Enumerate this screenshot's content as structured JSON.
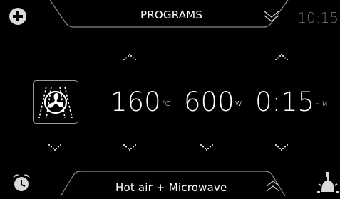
{
  "header": {
    "title": "PROGRAMS",
    "time": "10:15"
  },
  "settings": {
    "temperature": {
      "value": "160",
      "unit": "°C"
    },
    "power": {
      "value": "600",
      "unit": "W"
    },
    "duration": {
      "value": "0:15",
      "unit": "H:M"
    }
  },
  "footer": {
    "mode_label": "Hot air + Microwave"
  },
  "icons": {
    "add": "plus-circle-icon",
    "fan_mode": "fan-hot-air-icon",
    "alarm": "alarm-clock-icon",
    "light": "oven-light-icon",
    "collapse": "chevron-double-down-icon",
    "expand": "chevron-up-icon"
  },
  "colors": {
    "background": "#000000",
    "text": "#ffffff",
    "tab_border": "#8a8a8a",
    "clock": "#6e6e6e",
    "icon_fill": "#d9d9d9"
  }
}
